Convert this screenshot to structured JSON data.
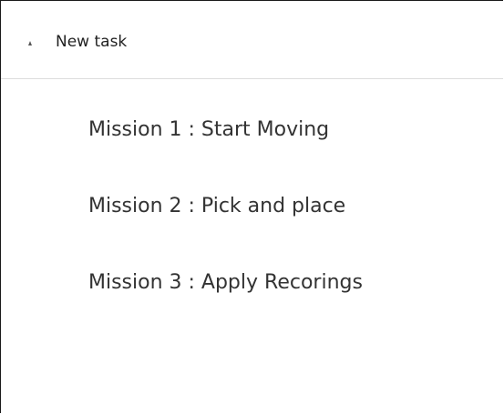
{
  "task": {
    "title": "New task",
    "toggle_icon": "triangle-up-icon",
    "expanded": true
  },
  "missions": [
    {
      "label": "Mission 1 : Start Moving"
    },
    {
      "label": "Mission 2 : Pick and place"
    },
    {
      "label": "Mission 3 : Apply Recorings"
    }
  ],
  "colors": {
    "border": "#1a1a1a",
    "divider": "#dcdcdc",
    "text": "#333333"
  }
}
